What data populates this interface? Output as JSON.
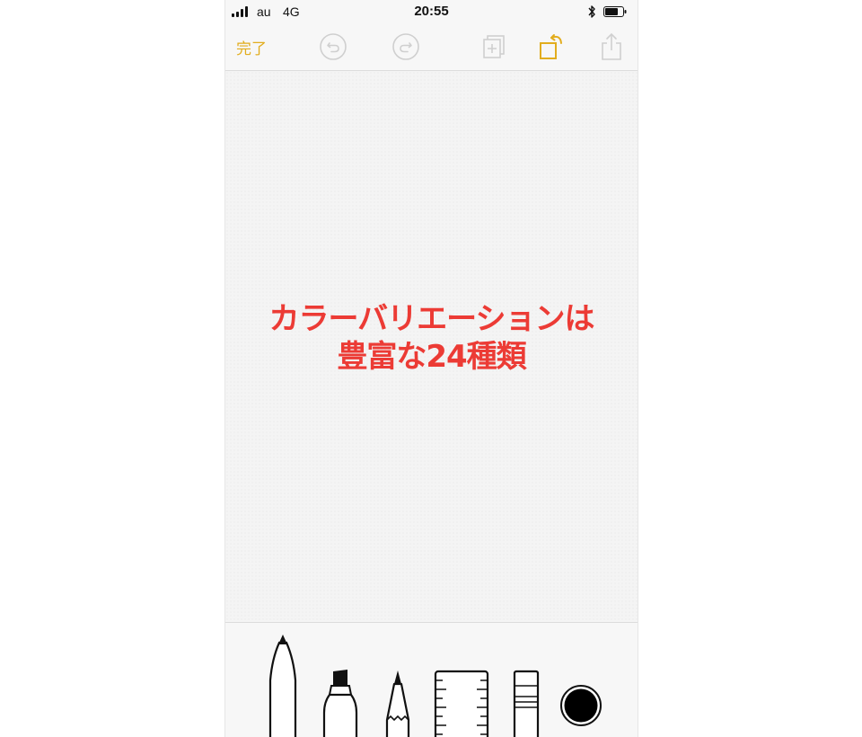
{
  "status_bar": {
    "carrier": "au",
    "network": "4G",
    "time": "20:55",
    "icons": [
      "signal-icon",
      "bluetooth-icon",
      "battery-icon"
    ]
  },
  "toolbar": {
    "done_label": "完了",
    "accent_color": "#e2ad1e",
    "icons": [
      "undo-icon",
      "redo-icon",
      "add-page-icon",
      "rotate-icon",
      "share-icon"
    ]
  },
  "canvas": {
    "caption_lines": [
      "カラーバリエーションは",
      "豊富な24種類"
    ],
    "caption_color": "#ec3b35"
  },
  "tools": {
    "items": [
      "pen-tool-icon",
      "marker-tool-icon",
      "pencil-tool-icon",
      "ruler-tool-icon",
      "eraser-tool-icon",
      "color-picker-icon"
    ],
    "selected_color": "#000000"
  }
}
